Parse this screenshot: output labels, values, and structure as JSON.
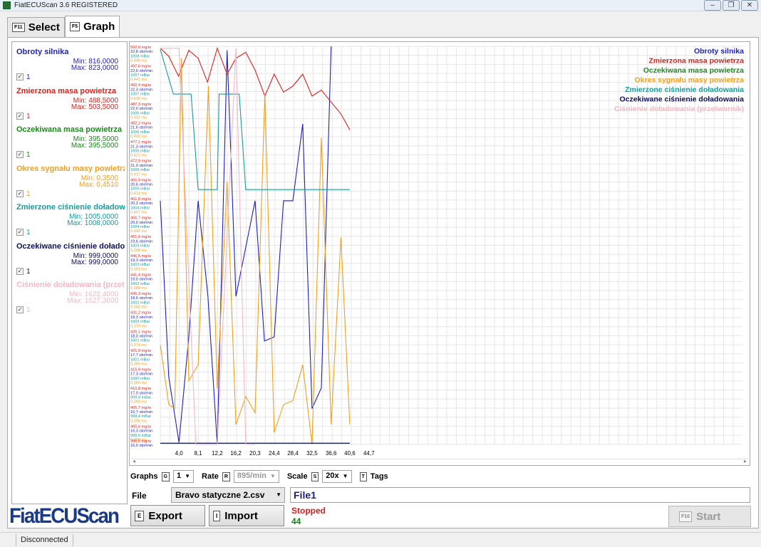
{
  "window": {
    "title": "FiatECUScan 3.6 REGISTERED"
  },
  "tabs": [
    {
      "key": "F11",
      "label": "Select"
    },
    {
      "key": "F5",
      "label": "Graph"
    }
  ],
  "params": [
    {
      "name": "Obroty silnika",
      "min": "Min: 816,0000",
      "max": "Max: 823,0000",
      "count": "1",
      "color": "#1f1fbf"
    },
    {
      "name": "Zmierzona masa powietrza",
      "min": "Min: 488,5000",
      "max": "Max: 503,5000",
      "count": "1",
      "color": "#e0201a"
    },
    {
      "name": "Oczekiwana masa powietrza",
      "min": "Min: 395,5000",
      "max": "Max: 395,5000",
      "count": "1",
      "color": "#1a8a1a"
    },
    {
      "name": "Okres sygnału masy powietrza",
      "min": "Min: 0,3500",
      "max": "Max: 0,4510",
      "count": "1",
      "color": "#f0a020"
    },
    {
      "name": "Zmierzone ciśnienie doładowania",
      "min": "Min: 1005,0000",
      "max": "Max: 1008,0000",
      "count": "1",
      "color": "#1a9a9a"
    },
    {
      "name": "Oczekiwane ciśnienie doładowania",
      "min": "Min: 999,0000",
      "max": "Max: 999,0000",
      "count": "1",
      "color": "#10105a"
    },
    {
      "name": "Ciśnienie doładowania (przetwornik)",
      "min": "Min: 1622,4000",
      "max": "Max: 1627,3000",
      "count": "1",
      "color": "#f4b8c4"
    }
  ],
  "logo": "FiatECUScan",
  "chart_data": {
    "type": "line",
    "x": [
      0,
      4.0,
      8.1,
      12.2,
      16.2,
      20.3,
      24.4,
      28.4,
      32.5,
      36.6,
      40.6,
      44.7
    ],
    "x_tick_labels": [
      "4,0",
      "8,1",
      "12,2",
      "16,2",
      "20,3",
      "24,4",
      "28,4",
      "32,5",
      "36,6",
      "40,6",
      "44,7"
    ],
    "legend": [
      "Obroty silnika",
      "Zmierzona masa powietrza",
      "Oczekiwana masa powietrza",
      "Okres sygnału masy powietrza",
      "Zmierzone ciśnienie doładowania",
      "Oczekiwane ciśnienie doładowania",
      "Ciśnienie doładowania (przetwornik)"
    ],
    "legend_position": "top-right",
    "grid": true,
    "y_axis_labels": [
      {
        "rpm": "22,8 obr/min",
        "mass": "502,6 mg/w",
        "bar": "1008 mBar",
        "ms": "0,446 ms"
      },
      {
        "rpm": "22,6 obr/min",
        "mass": "497,6 mg/w",
        "bar": "1007 mBar",
        "ms": "0,441 ms"
      },
      {
        "rpm": "22,3 obr/min",
        "mass": "492,4 mg/w",
        "bar": "1007 mBar",
        "ms": "0,436 ms"
      },
      {
        "rpm": "22,0 obr/min",
        "mass": "487,3 mg/w",
        "bar": "1006 mBar",
        "ms": "0,431 ms"
      },
      {
        "rpm": "21,6 obr/min",
        "mass": "482,2 mg/w",
        "bar": "1006 mBar",
        "ms": "0,426 ms"
      },
      {
        "rpm": "21,3 obr/min",
        "mass": "477,1 mg/w",
        "bar": "1005 mBar",
        "ms": "0,422 ms"
      },
      {
        "rpm": "21,0 obr/min",
        "mass": "472,0 mg/w",
        "bar": "1005 mBar",
        "ms": "0,417 ms"
      },
      {
        "rpm": "20,6 obr/min",
        "mass": "466,9 mg/w",
        "bar": "1005 mBar",
        "ms": "0,413 ms"
      },
      {
        "rpm": "20,3 obr/min",
        "mass": "461,8 mg/w",
        "bar": "1004 mBar",
        "ms": "0,407 ms"
      },
      {
        "rpm": "20,0 obr/min",
        "mass": "456,7 mg/w",
        "bar": "1004 mBar",
        "ms": "0,402 ms"
      },
      {
        "rpm": "19,6 obr/min",
        "mass": "451,6 mg/w",
        "bar": "1003 mBar",
        "ms": "0,398 ms"
      },
      {
        "rpm": "19,3 obr/min",
        "mass": "446,5 mg/w",
        "bar": "1003 mBar",
        "ms": "0,393 ms"
      },
      {
        "rpm": "19,0 obr/min",
        "mass": "441,4 mg/w",
        "bar": "1002 mBar",
        "ms": "0,388 ms"
      },
      {
        "rpm": "18,6 obr/min",
        "mass": "436,3 mg/w",
        "bar": "1002 mBar",
        "ms": "0,383 ms"
      },
      {
        "rpm": "18,3 obr/min",
        "mass": "431,2 mg/w",
        "bar": "1002 mBar",
        "ms": "0,379 ms"
      },
      {
        "rpm": "18,0 obr/min",
        "mass": "426,1 mg/w",
        "bar": "1001 mBar",
        "ms": "0,374 ms"
      },
      {
        "rpm": "17,7 obr/min",
        "mass": "421,0 mg/w",
        "bar": "1001 mBar",
        "ms": "0,369 ms"
      },
      {
        "rpm": "17,3 obr/min",
        "mass": "415,9 mg/w",
        "bar": "1000 mBar",
        "ms": "0,364 ms"
      },
      {
        "rpm": "17,0 obr/min",
        "mass": "410,8 mg/w",
        "bar": "999,9 mBar",
        "ms": "0,360 ms"
      },
      {
        "rpm": "16,7 obr/min",
        "mass": "405,7 mg/w",
        "bar": "999,4 mBar",
        "ms": "0,355 ms"
      },
      {
        "rpm": "16,3 obr/min",
        "mass": "400,6 mg/w",
        "bar": "999,0 mBar",
        "ms": "0,350 ms"
      },
      {
        "rpm": "16,0 obr/min",
        "mass": "395,5 mg/w",
        "bar": "",
        "ms": ""
      }
    ],
    "ylim": [
      0,
      1
    ],
    "series": [
      {
        "name": "Obroty silnika",
        "color": "#1f1fbf",
        "points": [
          [
            0,
            0.612
          ],
          [
            1.8,
            0.17
          ],
          [
            4.0,
            0.005
          ],
          [
            6.1,
            0.27
          ],
          [
            8.1,
            0.612
          ],
          [
            10.2,
            0.372
          ],
          [
            12.2,
            0.0
          ],
          [
            14.3,
            0.99
          ],
          [
            16.2,
            0.372
          ],
          [
            20.3,
            0.612
          ],
          [
            22.3,
            0.26
          ],
          [
            24.4,
            0.27
          ],
          [
            26.4,
            0.612
          ],
          [
            28.4,
            0.612
          ],
          [
            30.5,
            0.805
          ],
          [
            32.5,
            0.09
          ],
          [
            34.5,
            0.142
          ],
          [
            36.6,
            1.0
          ]
        ]
      },
      {
        "name": "Zmierzona masa powietrza",
        "color": "#e0201a",
        "points": [
          [
            0,
            0.995
          ],
          [
            1.8,
            0.975
          ],
          [
            3.9,
            0.925
          ],
          [
            6.1,
            0.99
          ],
          [
            8.1,
            0.97
          ],
          [
            10.1,
            0.91
          ],
          [
            12.2,
            0.995
          ],
          [
            14.3,
            0.93
          ],
          [
            16.2,
            0.97
          ],
          [
            18.3,
            0.985
          ],
          [
            20.3,
            0.94
          ],
          [
            22.4,
            0.875
          ],
          [
            24.4,
            0.93
          ],
          [
            26.4,
            0.885
          ],
          [
            28.4,
            0.9
          ],
          [
            30.5,
            0.93
          ],
          [
            32.5,
            0.875
          ],
          [
            34.5,
            0.89
          ],
          [
            36.6,
            0.86
          ],
          [
            38.7,
            0.83
          ],
          [
            40.6,
            0.79
          ]
        ]
      },
      {
        "name": "Oczekiwana masa powietrza",
        "color": "#1a8a1a",
        "points": [
          [
            0,
            0.003
          ],
          [
            40.6,
            0.003
          ]
        ]
      },
      {
        "name": "Okres sygnału masy powietrza",
        "color": "#f0a020",
        "points": [
          [
            0,
            0.25
          ],
          [
            1.8,
            0.1
          ],
          [
            3.1,
            0.09
          ],
          [
            4.5,
            0.97
          ],
          [
            6.1,
            0.16
          ],
          [
            8.1,
            0.2
          ],
          [
            10.3,
            0.9
          ],
          [
            12.2,
            0.14
          ],
          [
            14.3,
            0.66
          ],
          [
            16.2,
            0.05
          ],
          [
            18.3,
            0.12
          ],
          [
            20.3,
            0.08
          ],
          [
            22.4,
            0.88
          ],
          [
            24.4,
            0.03
          ],
          [
            26.4,
            0.1
          ],
          [
            28.4,
            0.11
          ],
          [
            30.5,
            0.2
          ],
          [
            32.5,
            0.0
          ],
          [
            34.5,
            0.77
          ],
          [
            36.6,
            0.05
          ],
          [
            38.7,
            0.52
          ],
          [
            40.6,
            0.05
          ]
        ]
      },
      {
        "name": "Zmierzone ciśnienie doładowania",
        "color": "#1a9a9a",
        "points": [
          [
            0,
            0.992
          ],
          [
            2.8,
            0.88
          ],
          [
            4.5,
            0.88
          ],
          [
            6.6,
            0.88
          ],
          [
            8.1,
            0.64
          ],
          [
            12.2,
            0.64
          ],
          [
            12.6,
            0.88
          ],
          [
            16.9,
            0.88
          ],
          [
            18.3,
            0.64
          ],
          [
            40.6,
            0.64
          ]
        ]
      },
      {
        "name": "Oczekiwane ciśnienie doładowania",
        "color": "#10105a",
        "points": [
          [
            0,
            0.003
          ],
          [
            40.6,
            0.003
          ]
        ]
      },
      {
        "name": "Ciśnienie doładowania (przetwornik)",
        "color": "#f4b8c4",
        "points": [
          [
            0,
            0.995
          ],
          [
            4.0,
            0.995
          ],
          [
            7.6,
            0.0
          ],
          [
            12.2,
            0.0
          ],
          [
            16.2,
            0.995
          ],
          [
            18.3,
            0.0
          ],
          [
            20.3,
            0.0
          ]
        ]
      }
    ]
  },
  "controls": {
    "graphs_label": "Graphs",
    "graphs_key": "G",
    "graphs_value": "1",
    "rate_label": "Rate",
    "rate_key": "R",
    "rate_value": "895/min",
    "scale_label": "Scale",
    "scale_key": "S",
    "scale_value": "20x",
    "tags_key": "T",
    "tags_label": "Tags"
  },
  "file": {
    "label": "File",
    "selected": "Bravo statyczne 2.csv",
    "name": "File1",
    "export_key": "E",
    "export_label": "Export",
    "import_key": "I",
    "import_label": "Import",
    "status": "Stopped",
    "counter": "44",
    "start_key": "F10",
    "start_label": "Start"
  },
  "statusbar": {
    "connection": "Disconnected"
  }
}
